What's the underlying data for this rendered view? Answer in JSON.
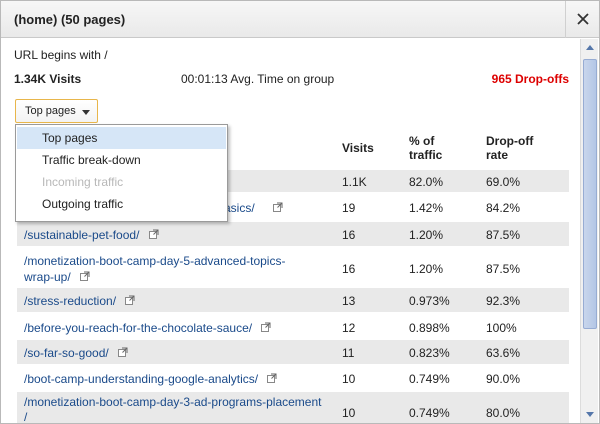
{
  "dialog": {
    "title": "(home) (50 pages)",
    "close_label": "×"
  },
  "summary": {
    "url_line": "URL begins with /",
    "visits": "1.34K Visits",
    "avg_time": "00:01:13 Avg. Time on group",
    "dropoffs": "965 Drop-offs"
  },
  "dropdown": {
    "label": "Top pages",
    "items": [
      {
        "label": "Top pages",
        "selected": true,
        "disabled": false
      },
      {
        "label": "Traffic break-down",
        "selected": false,
        "disabled": false
      },
      {
        "label": "Incoming traffic",
        "selected": false,
        "disabled": true
      },
      {
        "label": "Outgoing traffic",
        "selected": false,
        "disabled": false
      }
    ]
  },
  "table": {
    "headers": {
      "visits": "Visits",
      "pct_a": "% of",
      "pct_b": "traffic",
      "drop_a": "Drop-off",
      "drop_b": "rate"
    },
    "rows": [
      {
        "path_a": "",
        "path_b": "",
        "visits": "1.1K",
        "pct": "82.0%",
        "drop": "69.0%"
      },
      {
        "path_a": "asics/",
        "path_b": "",
        "visits": "19",
        "pct": "1.42%",
        "drop": "84.2%"
      },
      {
        "path_a": "/sustainable-pet-food/",
        "path_b": "",
        "visits": "16",
        "pct": "1.20%",
        "drop": "87.5%"
      },
      {
        "path_a": "/monetization-boot-camp-day-5-advanced-topics-",
        "path_b": "wrap-up/",
        "visits": "16",
        "pct": "1.20%",
        "drop": "87.5%"
      },
      {
        "path_a": "/stress-reduction/",
        "path_b": "",
        "visits": "13",
        "pct": "0.973%",
        "drop": "92.3%"
      },
      {
        "path_a": "/before-you-reach-for-the-chocolate-sauce/",
        "path_b": "",
        "visits": "12",
        "pct": "0.898%",
        "drop": "100%"
      },
      {
        "path_a": "/so-far-so-good/",
        "path_b": "",
        "visits": "11",
        "pct": "0.823%",
        "drop": "63.6%"
      },
      {
        "path_a": "/boot-camp-understanding-google-analytics/",
        "path_b": "",
        "visits": "10",
        "pct": "0.749%",
        "drop": "90.0%"
      },
      {
        "path_a": "/monetization-boot-camp-day-3-ad-programs-placement",
        "path_b": "/",
        "visits": "10",
        "pct": "0.749%",
        "drop": "80.0%"
      }
    ]
  },
  "icons": {
    "close": "close-icon",
    "dropdown_arrow": "chevron-down-icon",
    "external_link": "external-link-icon",
    "scroll_up": "scroll-up-arrow-icon",
    "scroll_down": "scroll-down-arrow-icon"
  },
  "colors": {
    "dropoffs_text": "#dd0000",
    "link": "#1a4a8a",
    "row_shade": "#e9e9e9",
    "menu_selected": "#d6e6f7",
    "dropdown_border": "#e8b64b",
    "scroll_thumb": "#b3c6e6"
  }
}
